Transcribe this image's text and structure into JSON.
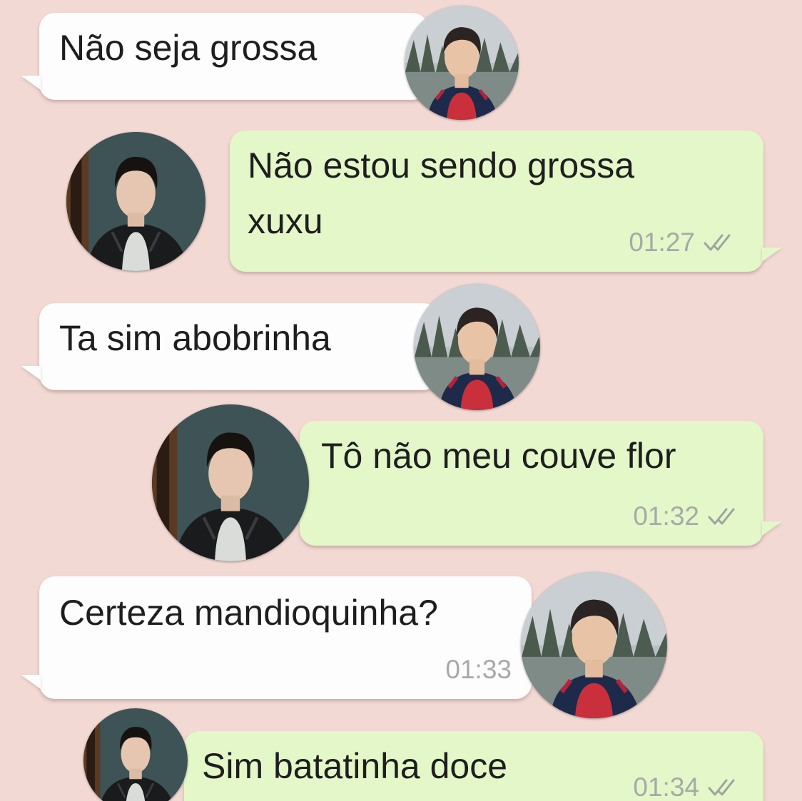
{
  "chat": {
    "messages": [
      {
        "direction": "incoming",
        "text": "Não seja grossa",
        "time": ""
      },
      {
        "direction": "outgoing",
        "text": [
          "Não estou sendo grossa",
          "xuxu"
        ],
        "time": "01:27",
        "status_icon": "double-check-icon"
      },
      {
        "direction": "incoming",
        "text": "Ta sim abobrinha",
        "time": ""
      },
      {
        "direction": "outgoing",
        "text": "Tô não meu couve flor",
        "time": "01:32",
        "status_icon": "double-check-icon"
      },
      {
        "direction": "incoming",
        "text": "Certeza mandioquinha?",
        "time": "01:33"
      },
      {
        "direction": "outgoing",
        "text": "Sim batatinha doce",
        "time": "01:34",
        "status_icon": "double-check-icon"
      }
    ]
  },
  "colors": {
    "background": "#f3d9d3",
    "incoming_bubble": "#fdfdfd",
    "outgoing_bubble": "#e4f7c9",
    "timestamp": "#a6aaa6"
  },
  "avatars": {
    "person_a": "avatar-outdoor-man-red-sweater",
    "person_b": "avatar-man-dark-jacket"
  }
}
